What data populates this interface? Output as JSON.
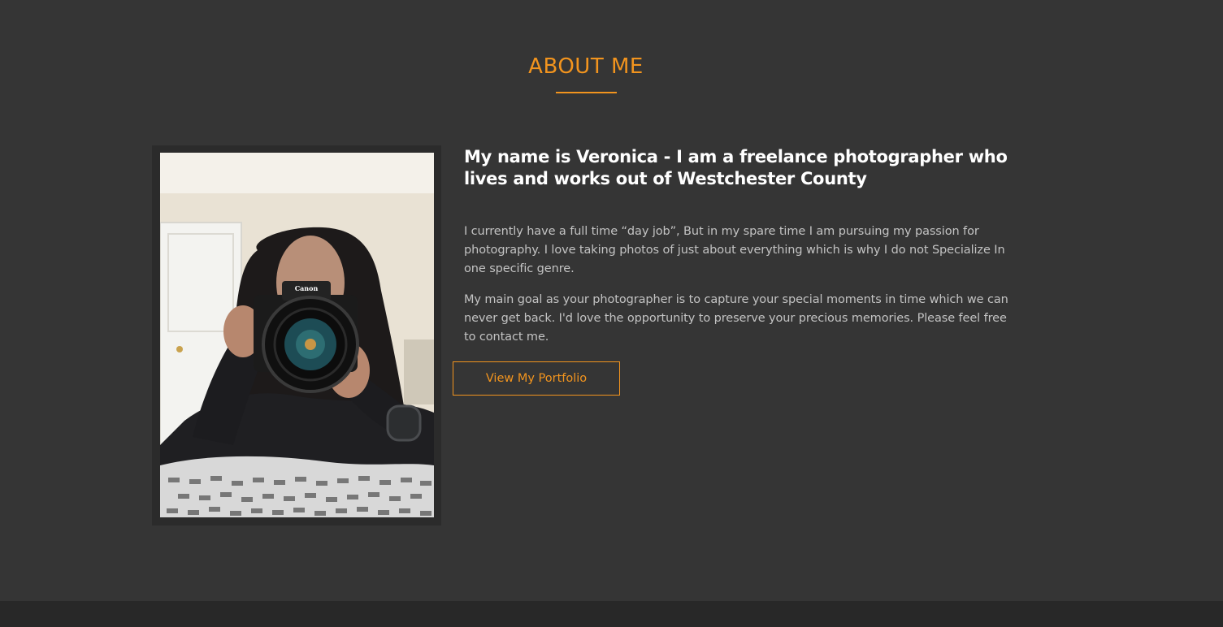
{
  "about": {
    "title": "ABOUT ME",
    "headline": "My name is Veronica - I am a freelance photographer who lives and works out of Westchester County",
    "paragraphs": [
      "I currently have a full time “day job”, But in my spare time I am pursuing my passion for photography. I love taking photos of just about everything which is why I do not Specialize In one specific genre.",
      "My main goal as your photographer is to capture your special moments in time which we can never get back. I'd love the opportunity to preserve your precious memories. Please feel free to contact me."
    ],
    "button_label": "View My Portfolio",
    "photo_description": "portrait photo of woman holding Canon camera",
    "camera_brand_text": "Canon"
  },
  "colors": {
    "background": "#353535",
    "accent": "#f2941e",
    "heading_text": "#ffffff",
    "body_text": "#c3c3c3",
    "footer": "#282828"
  }
}
